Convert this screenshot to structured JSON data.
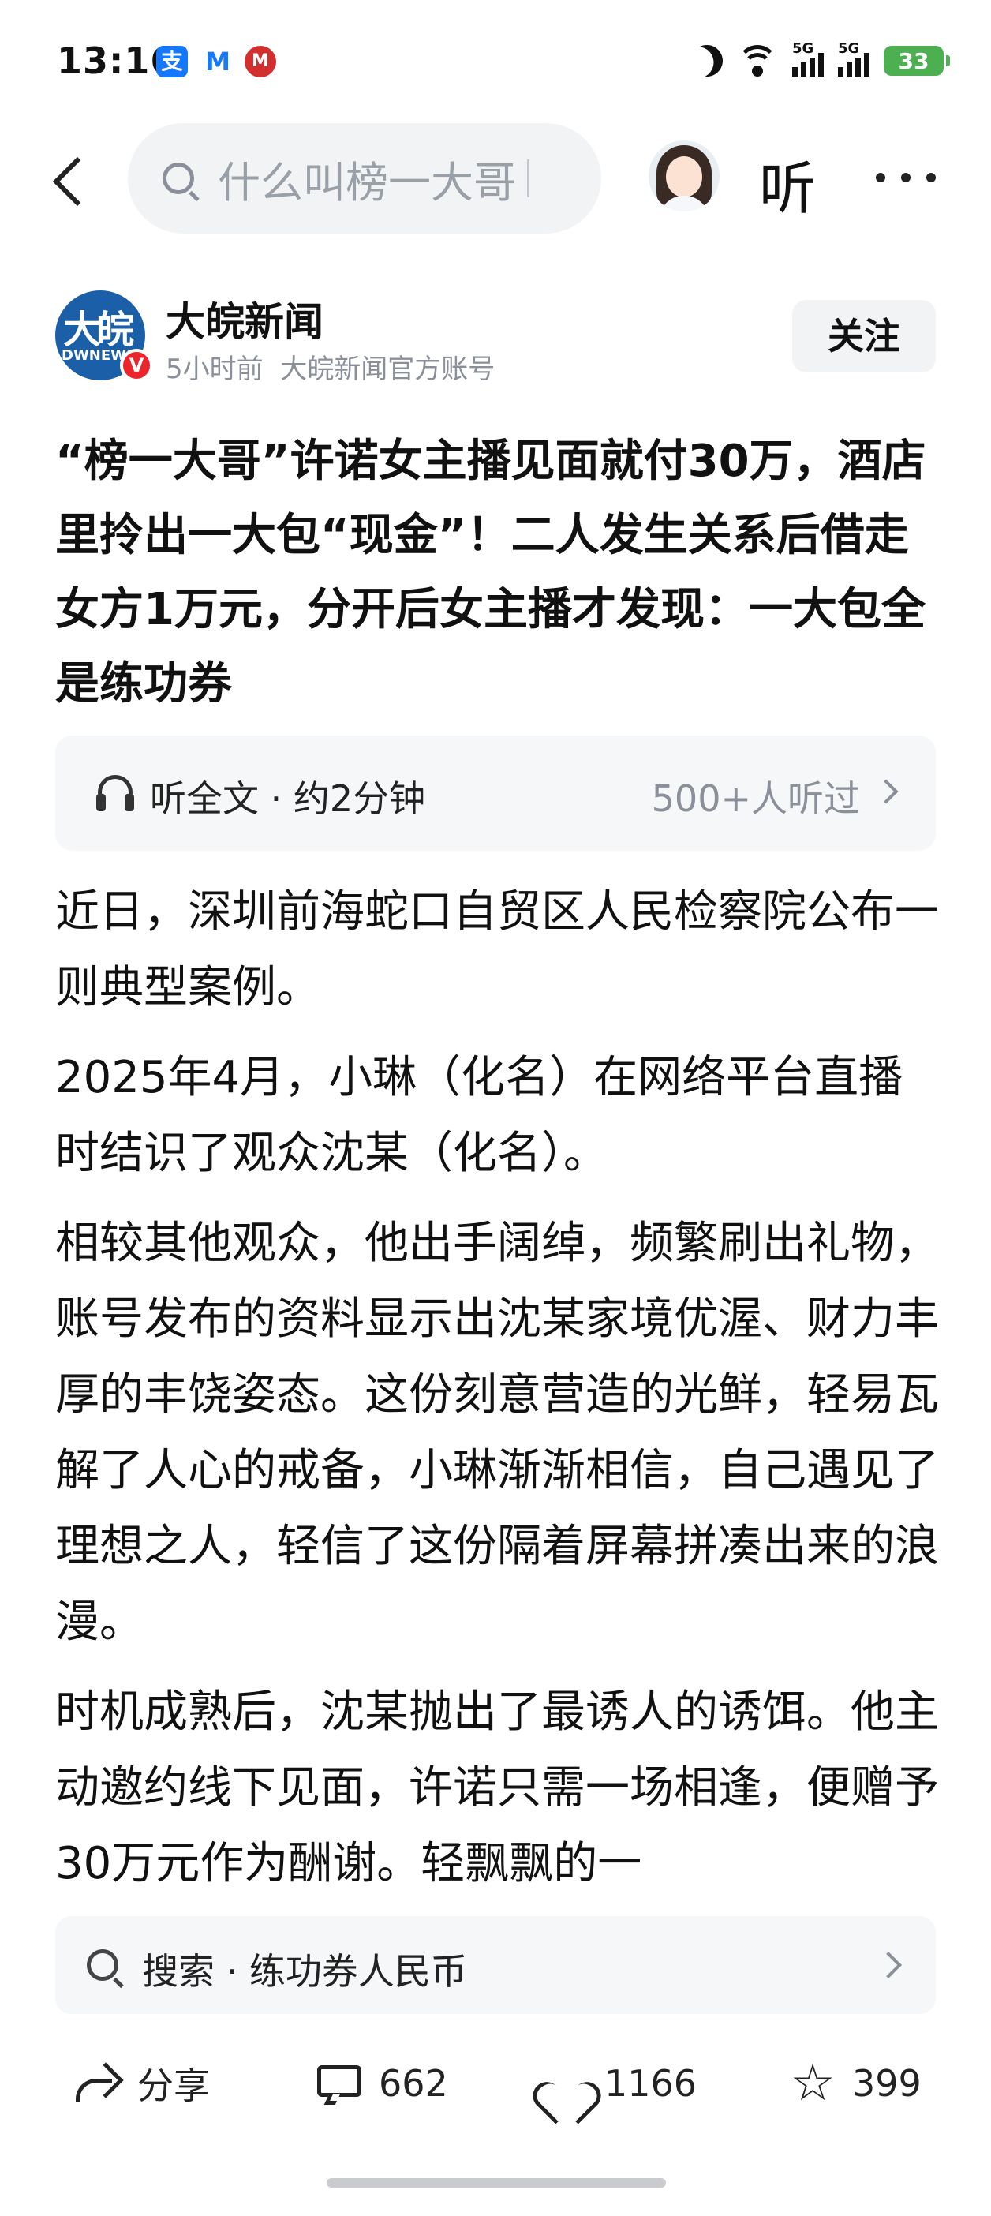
{
  "status_bar": {
    "time": "13:16",
    "app_icons": [
      {
        "name": "alipay-icon",
        "glyph": "支"
      },
      {
        "name": "metro-card-icon",
        "glyph": "M"
      },
      {
        "name": "bank-app-icon",
        "glyph": "M"
      }
    ],
    "network_1": "5G",
    "network_2": "5G",
    "battery": "33"
  },
  "top_nav": {
    "search_placeholder": "什么叫榜一大哥",
    "listen_label": "听"
  },
  "author": {
    "logo_text": "大皖",
    "logo_subtext": "DWNEWS",
    "verified_glyph": "V",
    "name": "大皖新闻",
    "time": "5小时前",
    "account_type": "大皖新闻官方账号",
    "follow_label": "关注"
  },
  "article": {
    "title": "“榜一大哥”许诺女主播见面就付30万，酒店里拎出一大包“现金”！二人发生关系后借走女方1万元，分开后女主播才发现：一大包全是练功券",
    "listen": {
      "label": "听全文 · 约2分钟",
      "count": "500+人听过"
    },
    "paragraphs": [
      "近日，深圳前海蛇口自贸区人民检察院公布一则典型案例。",
      "2025年4月，小琳（化名）在网络平台直播时结识了观众沈某（化名）。",
      "相较其他观众，他出手阔绰，频繁刷出礼物，账号发布的资料显示出沈某家境优渥、财力丰厚的丰饶姿态。这份刻意营造的光鲜，轻易瓦解了人心的戒备，小琳渐渐相信，自己遇见了理想之人，轻信了这份隔着屏幕拼凑出来的浪漫。",
      "时机成熟后，沈某抛出了最诱人的诱饵。他主动邀约线下见面，许诺只需一场相逢，便赠予30万元作为酬谢。轻飘飘的一"
    ]
  },
  "related_search": {
    "label": "搜索 · 练功券人民币"
  },
  "actions": {
    "share": "分享",
    "comments": "662",
    "likes": "1166",
    "favorites": "399"
  }
}
